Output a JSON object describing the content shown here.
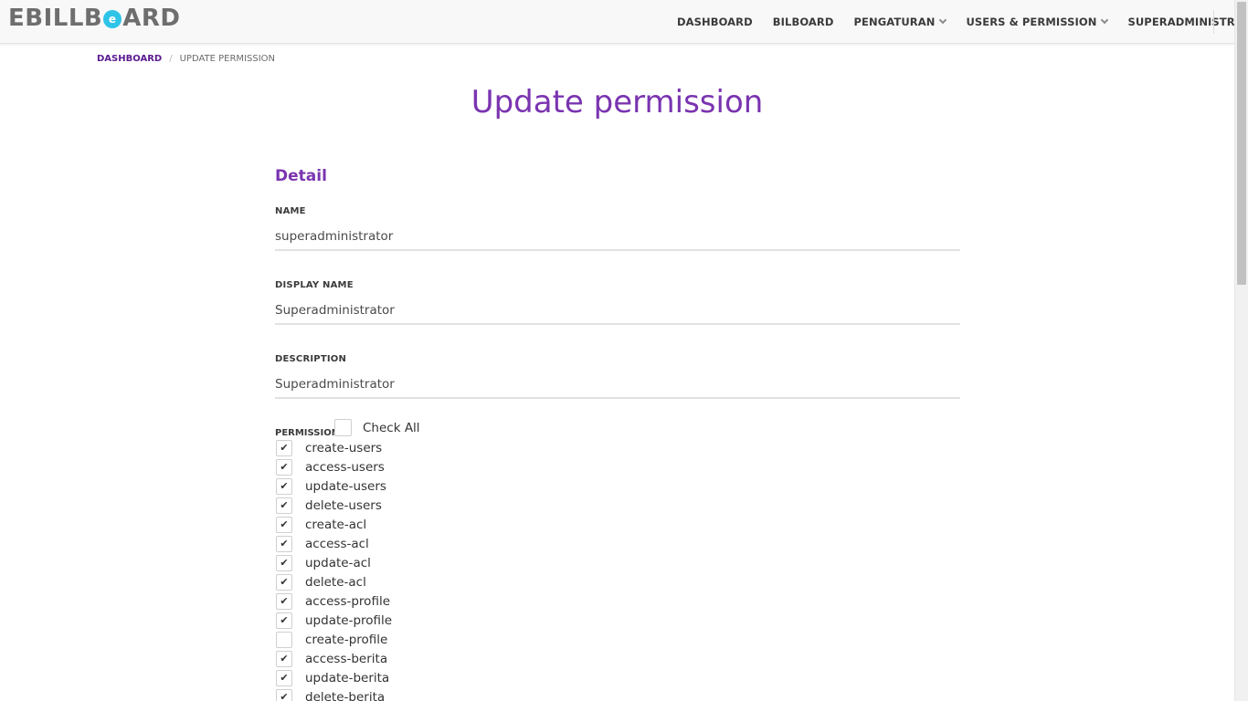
{
  "brand": {
    "logo_left": "EBILLB",
    "logo_o": "e",
    "logo_right": "ARD"
  },
  "nav": {
    "items": [
      {
        "label": "DASHBOARD",
        "dropdown": false
      },
      {
        "label": "BILBOARD",
        "dropdown": false
      },
      {
        "label": "PENGATURAN",
        "dropdown": true
      },
      {
        "label": "USERS & PERMISSION",
        "dropdown": true
      },
      {
        "label": "SUPERADMINISTRATOR",
        "dropdown": true
      }
    ]
  },
  "breadcrumb": {
    "home": "DASHBOARD",
    "current": "UPDATE PERMISSION"
  },
  "page": {
    "title": "Update permission",
    "section": "Detail"
  },
  "form": {
    "name": {
      "label": "NAME",
      "value": "superadministrator"
    },
    "display_name": {
      "label": "DISPLAY NAME",
      "value": "Superadministrator"
    },
    "description": {
      "label": "DESCRIPTION",
      "value": "Superadministrator"
    },
    "permission_label": "PERMISSION",
    "check_all_label": "Check All",
    "check_all_checked": false
  },
  "permissions": [
    {
      "name": "create-users",
      "checked": true
    },
    {
      "name": "access-users",
      "checked": true
    },
    {
      "name": "update-users",
      "checked": true
    },
    {
      "name": "delete-users",
      "checked": true
    },
    {
      "name": "create-acl",
      "checked": true
    },
    {
      "name": "access-acl",
      "checked": true
    },
    {
      "name": "update-acl",
      "checked": true
    },
    {
      "name": "delete-acl",
      "checked": true
    },
    {
      "name": "access-profile",
      "checked": true
    },
    {
      "name": "update-profile",
      "checked": true
    },
    {
      "name": "create-profile",
      "checked": false
    },
    {
      "name": "access-berita",
      "checked": true
    },
    {
      "name": "update-berita",
      "checked": true
    },
    {
      "name": "delete-berita",
      "checked": true
    }
  ],
  "colors": {
    "accent": "#7a34b0",
    "breadcrumb_link": "#5b1a8f",
    "logo_circle": "#2ec4e8"
  }
}
